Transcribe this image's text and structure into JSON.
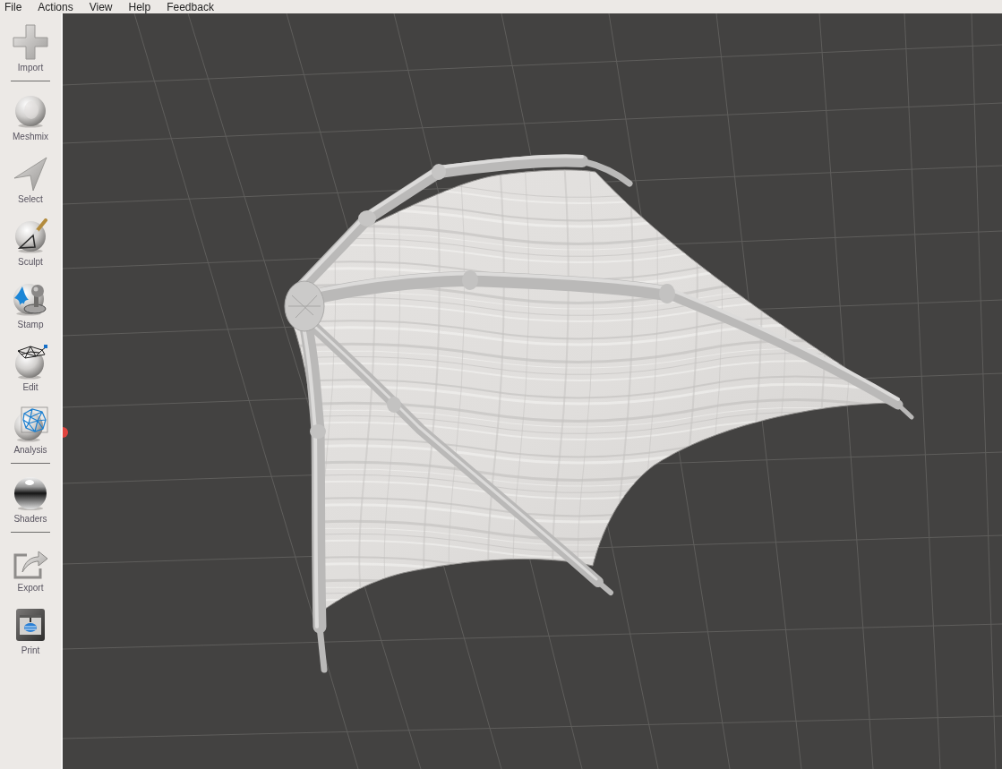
{
  "menu_bar": {
    "items": [
      "File",
      "Actions",
      "View",
      "Help",
      "Feedback"
    ]
  },
  "toolbar": {
    "groups": [
      {
        "tools": [
          {
            "label": "Import"
          }
        ]
      },
      {
        "tools": [
          {
            "label": "Meshmix"
          },
          {
            "label": "Select"
          },
          {
            "label": "Sculpt"
          },
          {
            "label": "Stamp"
          },
          {
            "label": "Edit"
          },
          {
            "label": "Analysis"
          }
        ]
      },
      {
        "tools": [
          {
            "label": "Shaders"
          }
        ]
      },
      {
        "tools": [
          {
            "label": "Export"
          },
          {
            "label": "Print"
          }
        ]
      }
    ]
  }
}
